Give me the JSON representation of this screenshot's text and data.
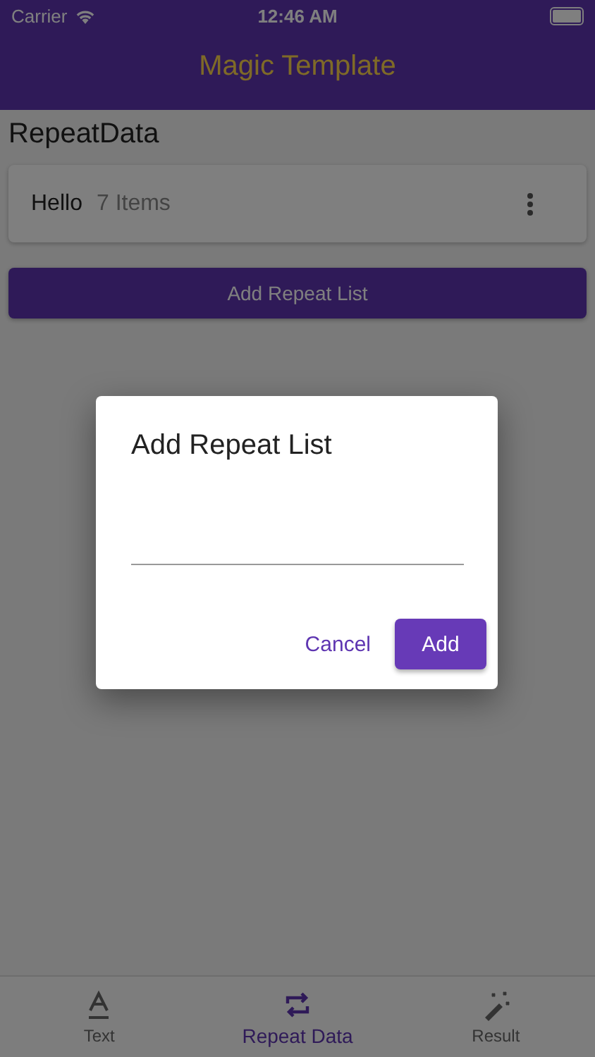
{
  "status_bar": {
    "carrier": "Carrier",
    "time": "12:46 AM"
  },
  "app_bar": {
    "title": "Magic Template"
  },
  "section_title": "RepeatData",
  "lists": [
    {
      "name": "Hello",
      "count": "7 Items"
    }
  ],
  "add_button": "Add Repeat List",
  "dialog": {
    "title": "Add Repeat List",
    "buttons": [
      {
        "label": "Cancel",
        "kind": "text"
      },
      {
        "label": "Add",
        "kind": "filled"
      }
    ]
  },
  "tabs": [
    {
      "label": "Text",
      "kind": "text",
      "selected": false
    },
    {
      "label": "Repeat Data",
      "kind": "repeat",
      "selected": true
    },
    {
      "label": "Result",
      "kind": "result",
      "selected": false
    }
  ]
}
